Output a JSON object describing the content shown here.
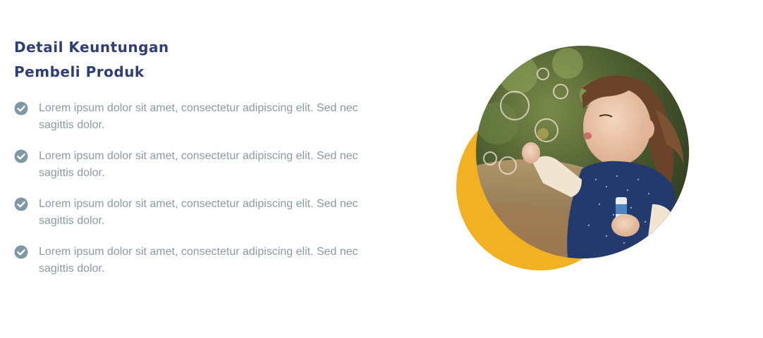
{
  "heading": {
    "line1": "Detail Keuntungan",
    "line2": "Pembeli Produk"
  },
  "benefits": [
    {
      "text": "Lorem ipsum dolor sit amet, consectetur adipiscing elit. Sed nec sagittis dolor.",
      "icon": "check-circle-icon"
    },
    {
      "text": "Lorem ipsum dolor sit amet, consectetur adipiscing elit. Sed nec sagittis dolor.",
      "icon": "check-circle-icon"
    },
    {
      "text": "Lorem ipsum dolor sit amet, consectetur adipiscing elit. Sed nec sagittis dolor.",
      "icon": "check-circle-icon"
    },
    {
      "text": "Lorem ipsum dolor sit amet, consectetur adipiscing elit. Sed nec sagittis dolor.",
      "icon": "check-circle-icon"
    }
  ],
  "colors": {
    "heading": "#2f3e74",
    "body_text": "#8a9aa5",
    "check_icon": "#7f98a3",
    "accent_circle": "#f2b122"
  },
  "image": {
    "subject": "child-blowing-bubbles-photo"
  }
}
